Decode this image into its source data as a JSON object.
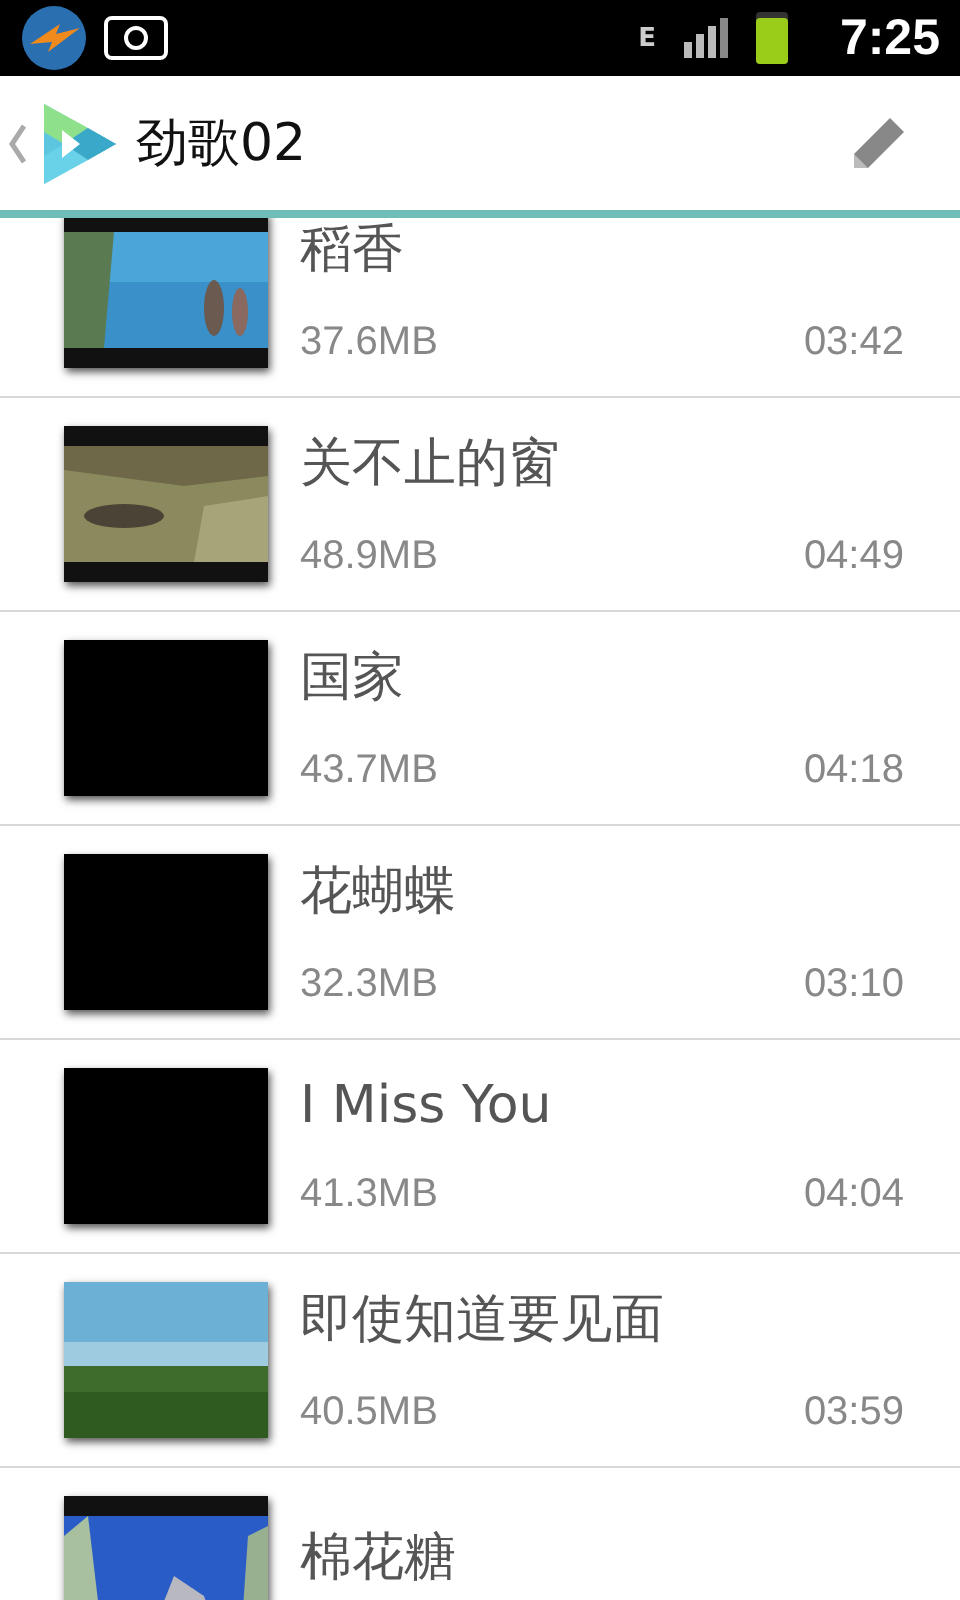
{
  "status_bar": {
    "network_type": "E",
    "time": "7:25"
  },
  "app_bar": {
    "title": "劲歌02"
  },
  "songs": [
    {
      "title": "稻香",
      "size": "37.6MB",
      "duration": "03:42"
    },
    {
      "title": "关不止的窗",
      "size": "48.9MB",
      "duration": "04:49"
    },
    {
      "title": "国家",
      "size": "43.7MB",
      "duration": "04:18",
      "thumbnail": {
        "kind": "blank"
      }
    },
    {
      "title": "花蝴蝶",
      "size": "32.3MB",
      "duration": "03:10",
      "thumbnail": {
        "kind": "blank"
      }
    },
    {
      "title": "I Miss You",
      "size": "41.3MB",
      "duration": "04:04",
      "thumbnail": {
        "kind": "blank"
      }
    },
    {
      "title": "即使知道要见面",
      "size": "40.5MB",
      "duration": "03:59"
    },
    {
      "title": "棉花糖"
    }
  ]
}
